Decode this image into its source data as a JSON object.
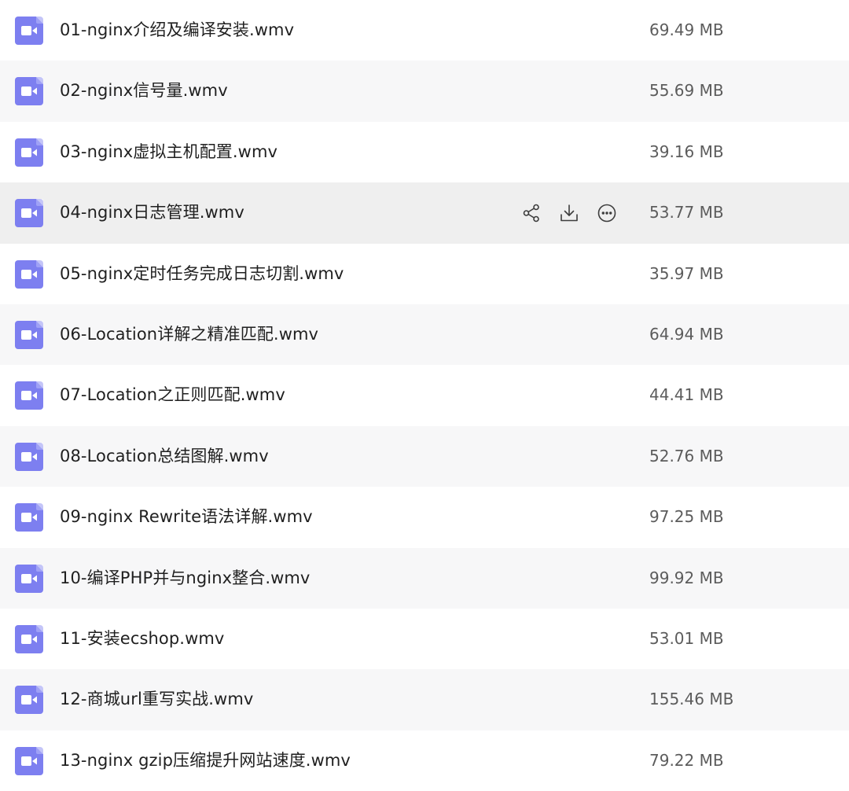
{
  "files": [
    {
      "name": "01-nginx介绍及编译安装.wmv",
      "size": "69.49 MB"
    },
    {
      "name": "02-nginx信号量.wmv",
      "size": "55.69 MB"
    },
    {
      "name": "03-nginx虚拟主机配置.wmv",
      "size": "39.16 MB"
    },
    {
      "name": "04-nginx日志管理.wmv",
      "size": "53.77 MB"
    },
    {
      "name": "05-nginx定时任务完成日志切割.wmv",
      "size": "35.97 MB"
    },
    {
      "name": "06-Location详解之精准匹配.wmv",
      "size": "64.94 MB"
    },
    {
      "name": "07-Location之正则匹配.wmv",
      "size": "44.41 MB"
    },
    {
      "name": "08-Location总结图解.wmv",
      "size": "52.76 MB"
    },
    {
      "name": "09-nginx Rewrite语法详解.wmv",
      "size": "97.25 MB"
    },
    {
      "name": "10-编译PHP并与nginx整合.wmv",
      "size": "99.92 MB"
    },
    {
      "name": "11-安装ecshop.wmv",
      "size": "53.01 MB"
    },
    {
      "name": "12-商城url重写实战.wmv",
      "size": "155.46 MB"
    },
    {
      "name": "13-nginx gzip压缩提升网站速度.wmv",
      "size": "79.22 MB"
    }
  ],
  "hovered_row": 3,
  "row_actions": [
    {
      "icon": "share-icon"
    },
    {
      "icon": "download-icon"
    },
    {
      "icon": "more-options-icon"
    }
  ],
  "colors": {
    "file_icon": "#7d7ff0",
    "stripe_background": "#f7f7f8",
    "hover_background": "#efefef"
  }
}
